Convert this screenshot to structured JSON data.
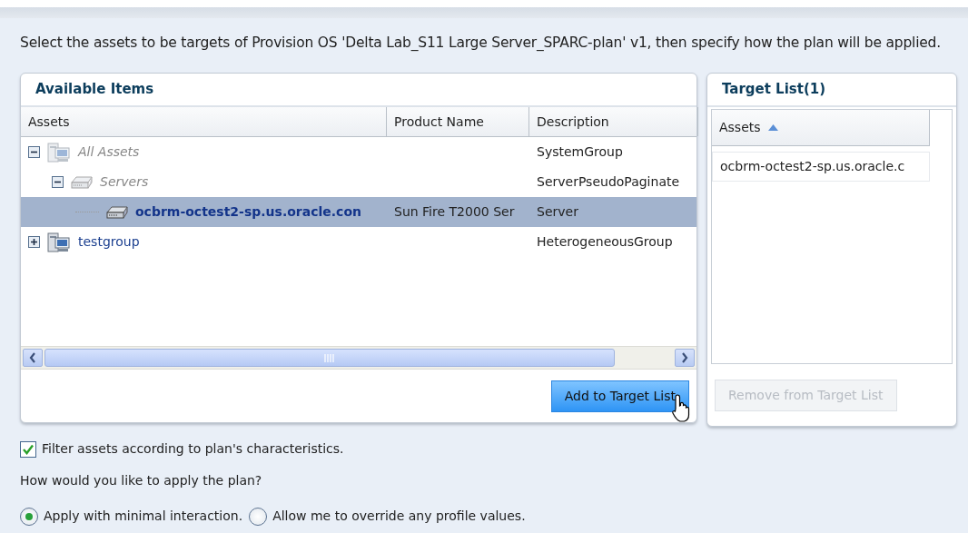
{
  "instruction": "Select the assets to be targets of Provision OS 'Delta Lab_S11 Large Server_SPARC-plan' v1, then specify how the plan will be applied.",
  "available_items": {
    "title": "Available Items",
    "columns": [
      "Assets",
      "Product Name",
      "Description"
    ],
    "tree": [
      {
        "label": "All Assets",
        "kind": "group",
        "description": "SystemGroup",
        "expanded": true,
        "disabled": true,
        "selected": false,
        "children": [
          {
            "label": "Servers",
            "kind": "server",
            "description": "ServerPseudoPaginate",
            "expanded": true,
            "disabled": true,
            "selected": false,
            "children": [
              {
                "label": "ocbrm-octest2-sp.us.oracle.con",
                "kind": "server",
                "product_name": "Sun Fire T2000 Ser",
                "description": "Server",
                "disabled": false,
                "selected": true
              }
            ]
          }
        ]
      },
      {
        "label": "testgroup",
        "kind": "group",
        "description": "HeterogeneousGroup",
        "expanded": false,
        "disabled": false,
        "selected": false
      }
    ],
    "add_button": {
      "label": "Add to Target List",
      "disabled": false
    }
  },
  "target_list": {
    "title": "Target List(1)",
    "column": "Assets",
    "rows": [
      "ocbrm-octest2-sp.us.oracle.c"
    ],
    "remove_button": {
      "label": "Remove from Target List",
      "disabled": true
    }
  },
  "filter_checkbox": {
    "label": "Filter assets according to plan's characteristics.",
    "checked": true
  },
  "question": "How would you like to apply the plan?",
  "apply_options": [
    {
      "label": "Apply with minimal interaction.",
      "selected": true
    },
    {
      "label": "Allow me to override any profile values.",
      "selected": false
    }
  ]
}
